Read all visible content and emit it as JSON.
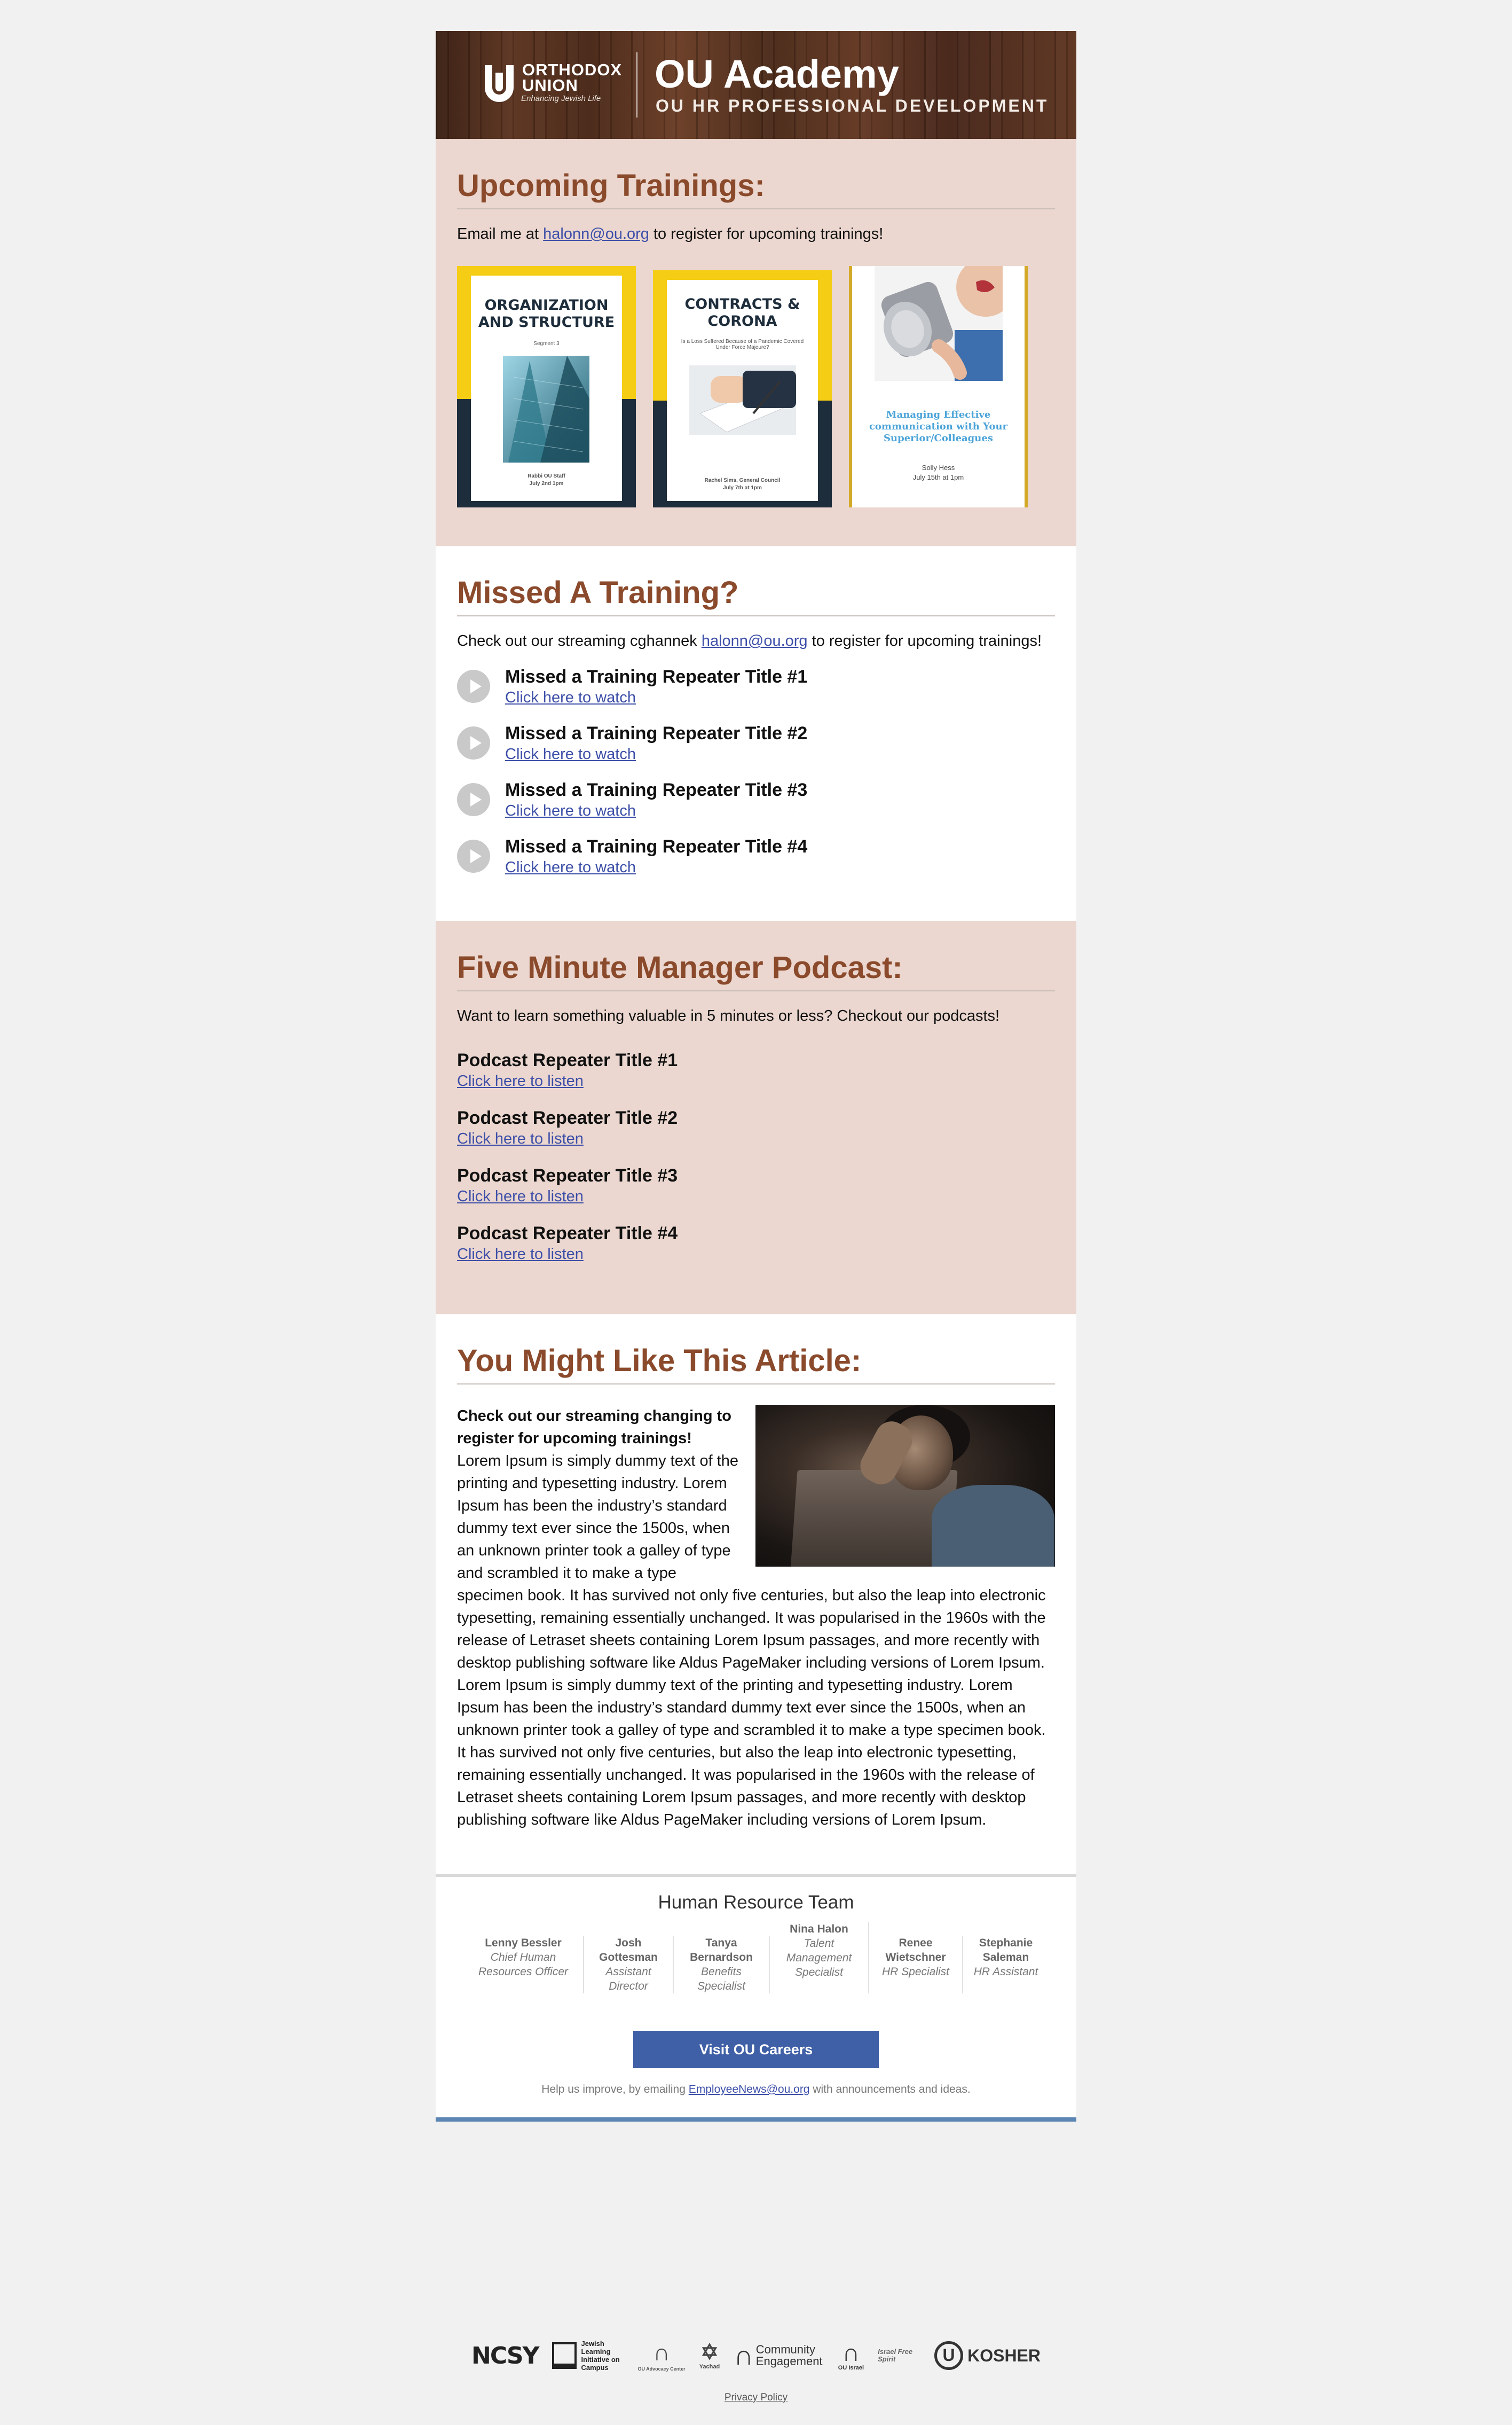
{
  "header": {
    "org_line1": "ORTHODOX",
    "org_line2": "UNION",
    "tagline": "Enhancing Jewish Life",
    "title": "OU Academy",
    "subtitle": "OU HR PROFESSIONAL DEVELOPMENT"
  },
  "upcoming": {
    "title": "Upcoming Trainings:",
    "intro_pre": "Email me at ",
    "email": "halonn@ou.org",
    "intro_post": " to register for upcoming trainings!",
    "posters": [
      {
        "title": "ORGANIZATION AND STRUCTURE",
        "line1": "Segment 3",
        "line2": "Rabbi OU Staff",
        "line3": "July 2nd 1pm"
      },
      {
        "title": "CONTRACTS & CORONA",
        "line1": "Is a Loss Suffered Because of a Pandemic Covered Under Force Majeure?",
        "line2": "Rachel Sims, General Council",
        "line3": "July 7th at 1pm"
      },
      {
        "title": "Managing Effective communication with Your Superior/Colleagues",
        "line2": "Solly Hess",
        "line3": "July 15th at 1pm"
      }
    ]
  },
  "missed": {
    "title": "Missed A Training?",
    "intro_pre": "Check out our streaming cghannek ",
    "email": "halonn@ou.org",
    "intro_post": " to register for upcoming trainings!",
    "items": [
      {
        "title": "Missed a Training Repeater Title #1",
        "link": "Click here to watch"
      },
      {
        "title": "Missed a Training Repeater Title #2",
        "link": "Click here to watch"
      },
      {
        "title": "Missed a Training Repeater Title #3",
        "link": "Click here to watch"
      },
      {
        "title": "Missed a Training Repeater Title #4",
        "link": "Click here to watch"
      }
    ]
  },
  "podcast": {
    "title": "Five Minute Manager Podcast:",
    "intro": "Want to learn something valuable in 5 minutes or less? Checkout our podcasts!",
    "items": [
      {
        "title": "Podcast Repeater Title #1",
        "link": "Click here to listen"
      },
      {
        "title": "Podcast Repeater Title #2",
        "link": "Click here to listen"
      },
      {
        "title": "Podcast Repeater Title #3",
        "link": "Click here to listen"
      },
      {
        "title": "Podcast Repeater Title #4",
        "link": "Click here to listen"
      }
    ]
  },
  "article": {
    "title": "You Might Like This Article:",
    "lead": "Check out our streaming changing to register for upcoming trainings!",
    "para1": "Lorem Ipsum is simply dummy text of the printing and typesetting industry. Lorem Ipsum has been the industry’s standard dummy text ever since the 1500s, when an unknown printer took a galley of type and scrambled it to make a type specimen book. It has survived not only five centuries, but also the leap into electronic typesetting, remaining essentially unchanged. It was popularised in the 1960s with the release of Letraset sheets containing Lorem Ipsum passages, and more recently with desktop publishing software like Aldus PageMaker including versions of Lorem Ipsum.",
    "para2": "Lorem Ipsum is simply dummy text of the printing and typesetting industry. Lorem Ipsum has been the industry’s standard dummy text ever since the 1500s, when an unknown printer took a galley of type and scrambled it to make a type specimen book. It has survived not only five centuries, but also the leap into electronic typesetting, remaining essentially unchanged. It was popularised in the 1960s with the release of Letraset sheets containing Lorem Ipsum passages, and more recently with desktop publishing software like Aldus PageMaker including versions of Lorem Ipsum."
  },
  "team": {
    "title": "Human Resource Team",
    "members": [
      {
        "name": "Lenny Bessler",
        "role": "Chief Human Resources Officer"
      },
      {
        "name": "Josh Gottesman",
        "role": "Assistant Director"
      },
      {
        "name": "Tanya Bernardson",
        "role": "Benefits Specialist"
      },
      {
        "name": "Nina Halon",
        "role": "Talent Management Specialist"
      },
      {
        "name": "Renee Wietschner",
        "role": "HR Specialist"
      },
      {
        "name": "Stephanie Saleman",
        "role": "HR Assistant"
      }
    ]
  },
  "footer": {
    "careers_label": "Visit OU Careers",
    "improve_pre": "Help us improve, by emailing ",
    "improve_email": "EmployeeNews@ou.org",
    "improve_post": " with announcements and ideas.",
    "logos": [
      "NCSY",
      "Jewish Learning Initiative on Campus",
      "OU Advocacy Center",
      "Yachad",
      "Community Engagement",
      "OU Israel",
      "Israel Free Spirit",
      "KOSHER"
    ],
    "privacy": "Privacy Policy"
  },
  "colors": {
    "heading": "#8a4a2b",
    "pink_bg": "#ebd7cf",
    "button": "#3f5fa6",
    "rule": "#5b86b3",
    "poster_yellow": "#f5cd14",
    "poster_navy": "#1e2d3b"
  }
}
